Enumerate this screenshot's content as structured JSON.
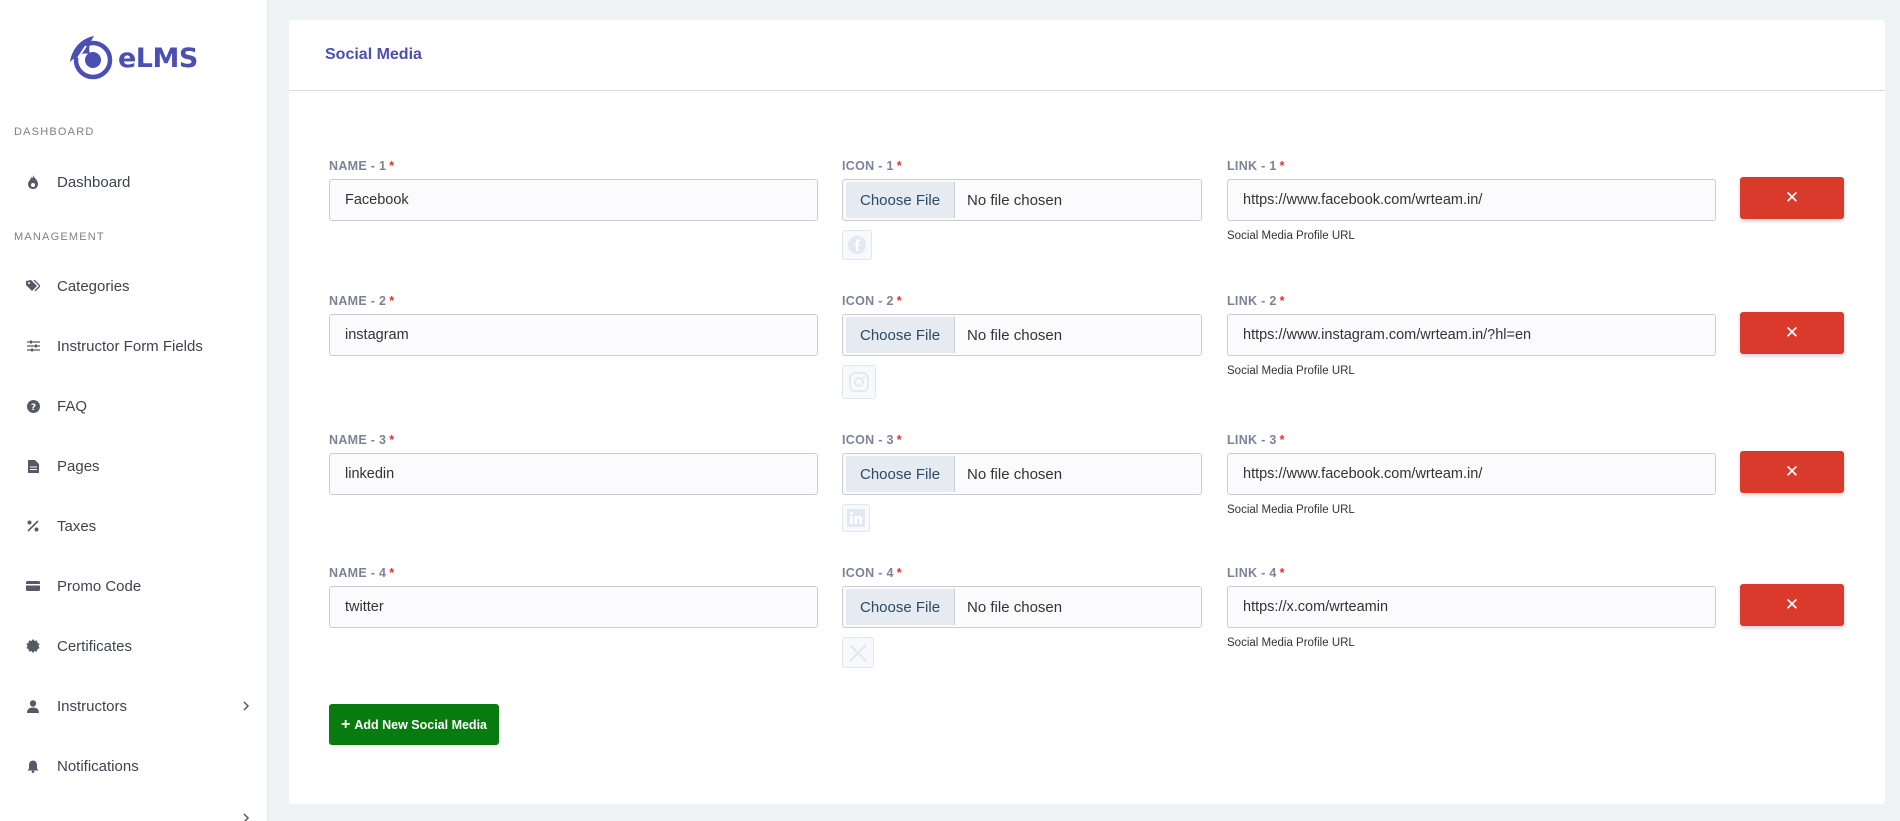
{
  "app": {
    "logo_text": "eLMS"
  },
  "sidebar": {
    "sections": [
      {
        "label": "DASHBOARD"
      },
      {
        "label": "MANAGEMENT"
      }
    ],
    "items": [
      {
        "label": "Dashboard",
        "icon": "flame-icon"
      },
      {
        "label": "Categories",
        "icon": "tags-icon"
      },
      {
        "label": "Instructor Form Fields",
        "icon": "sliders-icon"
      },
      {
        "label": "FAQ",
        "icon": "question-circle-icon"
      },
      {
        "label": "Pages",
        "icon": "document-icon"
      },
      {
        "label": "Taxes",
        "icon": "percent-icon"
      },
      {
        "label": "Promo Code",
        "icon": "ticket-icon"
      },
      {
        "label": "Certificates",
        "icon": "badge-icon"
      },
      {
        "label": "Instructors",
        "icon": "user-icon",
        "has_submenu": true
      },
      {
        "label": "Notifications",
        "icon": "bell-icon"
      }
    ]
  },
  "card": {
    "title": "Social Media"
  },
  "social_media": [
    {
      "name_label": "NAME - 1",
      "name_value": "Facebook",
      "icon_label": "ICON - 1",
      "file_button": "Choose File",
      "file_status": "No file chosen",
      "icon": "facebook-icon",
      "link_label": "LINK - 1",
      "link_value": "https://www.facebook.com/wrteam.in/",
      "help": "Social Media Profile URL",
      "remove": "✕"
    },
    {
      "name_label": "NAME - 2",
      "name_value": "instagram",
      "icon_label": "ICON - 2",
      "file_button": "Choose File",
      "file_status": "No file chosen",
      "icon": "instagram-icon",
      "link_label": "LINK - 2",
      "link_value": "https://www.instagram.com/wrteam.in/?hl=en",
      "help": "Social Media Profile URL",
      "remove": "✕"
    },
    {
      "name_label": "NAME - 3",
      "name_value": "linkedin",
      "icon_label": "ICON - 3",
      "file_button": "Choose File",
      "file_status": "No file chosen",
      "icon": "linkedin-icon",
      "link_label": "LINK - 3",
      "link_value": "https://www.facebook.com/wrteam.in/",
      "help": "Social Media Profile URL",
      "remove": "✕"
    },
    {
      "name_label": "NAME - 4",
      "name_value": "twitter",
      "icon_label": "ICON - 4",
      "file_button": "Choose File",
      "file_status": "No file chosen",
      "icon": "x-twitter-icon",
      "link_label": "LINK - 4",
      "link_value": "https://x.com/wrteamin",
      "help": "Social Media Profile URL",
      "remove": "✕"
    }
  ],
  "add_button": {
    "label": "Add New Social Media"
  },
  "colors": {
    "brand": "#4a4fb3",
    "danger": "#d93a2b",
    "success": "#087b10",
    "required": "#e0302a"
  }
}
